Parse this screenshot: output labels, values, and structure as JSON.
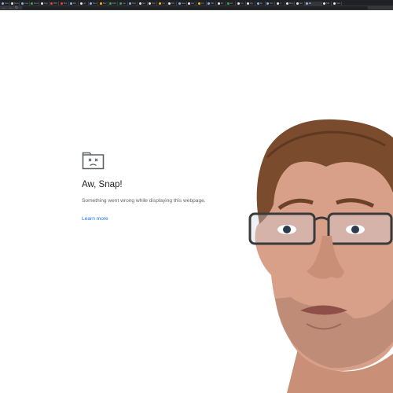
{
  "tabs": [
    {
      "label": "Sea",
      "color": "#8ab4f8"
    },
    {
      "label": "Goo",
      "color": "#e8eaed"
    },
    {
      "label": "Goo",
      "color": "#8ab4f8"
    },
    {
      "label": "Goo",
      "color": "#34a853"
    },
    {
      "label": "Ryp",
      "color": "#e8eaed"
    },
    {
      "label": "RNI",
      "color": "#ea4335"
    },
    {
      "label": "Bra",
      "color": "#ea4335"
    },
    {
      "label": "Dic",
      "color": "#8ab4f8"
    },
    {
      "label": "Ho",
      "color": "#e8eaed"
    },
    {
      "label": "Net",
      "color": "#8ab4f8"
    },
    {
      "label": "Buc",
      "color": "#fbbc04"
    },
    {
      "label": "Ebc",
      "color": "#34a853"
    },
    {
      "label": "Ga",
      "color": "#34a853"
    },
    {
      "label": "Sim",
      "color": "#8ab4f8"
    },
    {
      "label": "Spi",
      "color": "#e8eaed"
    },
    {
      "label": "Tes",
      "color": "#e8eaed"
    },
    {
      "label": "Fre",
      "color": "#fbbc04"
    },
    {
      "label": "Gh",
      "color": "#e8eaed"
    },
    {
      "label": "Sea",
      "color": "#8ab4f8"
    },
    {
      "label": "tes",
      "color": "#e8eaed"
    },
    {
      "label": "Go",
      "color": "#fbbc04"
    },
    {
      "label": "Mil",
      "color": "#8ab4f8"
    },
    {
      "label": "Sh",
      "color": "#e8eaed"
    },
    {
      "label": "Lit",
      "color": "#34a853"
    },
    {
      "label": "Go",
      "color": "#e8eaed"
    },
    {
      "label": "Qu",
      "color": "#e8eaed"
    },
    {
      "label": "Sp",
      "color": "#8ab4f8"
    },
    {
      "label": "Sto",
      "color": "#8ab4f8"
    },
    {
      "label": "lic",
      "color": "#e8eaed"
    },
    {
      "label": "Rep",
      "color": "#e8eaed"
    },
    {
      "label": "Sel",
      "color": "#e8eaed"
    },
    {
      "label": "Hi",
      "color": "#8ab4f8"
    },
    {
      "label": "Ma",
      "color": "#e8eaed"
    },
    {
      "label": "Nea",
      "color": "#e8eaed"
    }
  ],
  "error": {
    "title": "Aw, Snap!",
    "description": "Something went wrong while displaying this webpage.",
    "link_label": "Learn more"
  },
  "colors": {
    "title": "#202124",
    "description": "#5f6368",
    "link": "#1a73e8",
    "frame": "#202124"
  }
}
